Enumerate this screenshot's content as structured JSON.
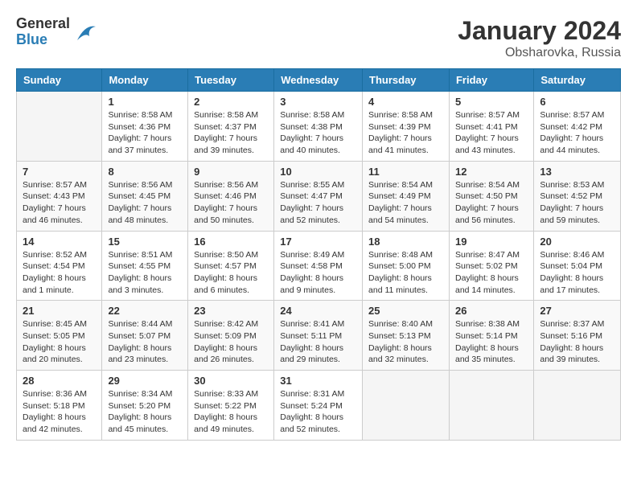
{
  "logo": {
    "general": "General",
    "blue": "Blue"
  },
  "title": {
    "month_year": "January 2024",
    "location": "Obsharovka, Russia"
  },
  "days_of_week": [
    "Sunday",
    "Monday",
    "Tuesday",
    "Wednesday",
    "Thursday",
    "Friday",
    "Saturday"
  ],
  "weeks": [
    [
      {
        "day": "",
        "sunrise": "",
        "sunset": "",
        "daylight": ""
      },
      {
        "day": "1",
        "sunrise": "Sunrise: 8:58 AM",
        "sunset": "Sunset: 4:36 PM",
        "daylight": "Daylight: 7 hours and 37 minutes."
      },
      {
        "day": "2",
        "sunrise": "Sunrise: 8:58 AM",
        "sunset": "Sunset: 4:37 PM",
        "daylight": "Daylight: 7 hours and 39 minutes."
      },
      {
        "day": "3",
        "sunrise": "Sunrise: 8:58 AM",
        "sunset": "Sunset: 4:38 PM",
        "daylight": "Daylight: 7 hours and 40 minutes."
      },
      {
        "day": "4",
        "sunrise": "Sunrise: 8:58 AM",
        "sunset": "Sunset: 4:39 PM",
        "daylight": "Daylight: 7 hours and 41 minutes."
      },
      {
        "day": "5",
        "sunrise": "Sunrise: 8:57 AM",
        "sunset": "Sunset: 4:41 PM",
        "daylight": "Daylight: 7 hours and 43 minutes."
      },
      {
        "day": "6",
        "sunrise": "Sunrise: 8:57 AM",
        "sunset": "Sunset: 4:42 PM",
        "daylight": "Daylight: 7 hours and 44 minutes."
      }
    ],
    [
      {
        "day": "7",
        "sunrise": "Sunrise: 8:57 AM",
        "sunset": "Sunset: 4:43 PM",
        "daylight": "Daylight: 7 hours and 46 minutes."
      },
      {
        "day": "8",
        "sunrise": "Sunrise: 8:56 AM",
        "sunset": "Sunset: 4:45 PM",
        "daylight": "Daylight: 7 hours and 48 minutes."
      },
      {
        "day": "9",
        "sunrise": "Sunrise: 8:56 AM",
        "sunset": "Sunset: 4:46 PM",
        "daylight": "Daylight: 7 hours and 50 minutes."
      },
      {
        "day": "10",
        "sunrise": "Sunrise: 8:55 AM",
        "sunset": "Sunset: 4:47 PM",
        "daylight": "Daylight: 7 hours and 52 minutes."
      },
      {
        "day": "11",
        "sunrise": "Sunrise: 8:54 AM",
        "sunset": "Sunset: 4:49 PM",
        "daylight": "Daylight: 7 hours and 54 minutes."
      },
      {
        "day": "12",
        "sunrise": "Sunrise: 8:54 AM",
        "sunset": "Sunset: 4:50 PM",
        "daylight": "Daylight: 7 hours and 56 minutes."
      },
      {
        "day": "13",
        "sunrise": "Sunrise: 8:53 AM",
        "sunset": "Sunset: 4:52 PM",
        "daylight": "Daylight: 7 hours and 59 minutes."
      }
    ],
    [
      {
        "day": "14",
        "sunrise": "Sunrise: 8:52 AM",
        "sunset": "Sunset: 4:54 PM",
        "daylight": "Daylight: 8 hours and 1 minute."
      },
      {
        "day": "15",
        "sunrise": "Sunrise: 8:51 AM",
        "sunset": "Sunset: 4:55 PM",
        "daylight": "Daylight: 8 hours and 3 minutes."
      },
      {
        "day": "16",
        "sunrise": "Sunrise: 8:50 AM",
        "sunset": "Sunset: 4:57 PM",
        "daylight": "Daylight: 8 hours and 6 minutes."
      },
      {
        "day": "17",
        "sunrise": "Sunrise: 8:49 AM",
        "sunset": "Sunset: 4:58 PM",
        "daylight": "Daylight: 8 hours and 9 minutes."
      },
      {
        "day": "18",
        "sunrise": "Sunrise: 8:48 AM",
        "sunset": "Sunset: 5:00 PM",
        "daylight": "Daylight: 8 hours and 11 minutes."
      },
      {
        "day": "19",
        "sunrise": "Sunrise: 8:47 AM",
        "sunset": "Sunset: 5:02 PM",
        "daylight": "Daylight: 8 hours and 14 minutes."
      },
      {
        "day": "20",
        "sunrise": "Sunrise: 8:46 AM",
        "sunset": "Sunset: 5:04 PM",
        "daylight": "Daylight: 8 hours and 17 minutes."
      }
    ],
    [
      {
        "day": "21",
        "sunrise": "Sunrise: 8:45 AM",
        "sunset": "Sunset: 5:05 PM",
        "daylight": "Daylight: 8 hours and 20 minutes."
      },
      {
        "day": "22",
        "sunrise": "Sunrise: 8:44 AM",
        "sunset": "Sunset: 5:07 PM",
        "daylight": "Daylight: 8 hours and 23 minutes."
      },
      {
        "day": "23",
        "sunrise": "Sunrise: 8:42 AM",
        "sunset": "Sunset: 5:09 PM",
        "daylight": "Daylight: 8 hours and 26 minutes."
      },
      {
        "day": "24",
        "sunrise": "Sunrise: 8:41 AM",
        "sunset": "Sunset: 5:11 PM",
        "daylight": "Daylight: 8 hours and 29 minutes."
      },
      {
        "day": "25",
        "sunrise": "Sunrise: 8:40 AM",
        "sunset": "Sunset: 5:13 PM",
        "daylight": "Daylight: 8 hours and 32 minutes."
      },
      {
        "day": "26",
        "sunrise": "Sunrise: 8:38 AM",
        "sunset": "Sunset: 5:14 PM",
        "daylight": "Daylight: 8 hours and 35 minutes."
      },
      {
        "day": "27",
        "sunrise": "Sunrise: 8:37 AM",
        "sunset": "Sunset: 5:16 PM",
        "daylight": "Daylight: 8 hours and 39 minutes."
      }
    ],
    [
      {
        "day": "28",
        "sunrise": "Sunrise: 8:36 AM",
        "sunset": "Sunset: 5:18 PM",
        "daylight": "Daylight: 8 hours and 42 minutes."
      },
      {
        "day": "29",
        "sunrise": "Sunrise: 8:34 AM",
        "sunset": "Sunset: 5:20 PM",
        "daylight": "Daylight: 8 hours and 45 minutes."
      },
      {
        "day": "30",
        "sunrise": "Sunrise: 8:33 AM",
        "sunset": "Sunset: 5:22 PM",
        "daylight": "Daylight: 8 hours and 49 minutes."
      },
      {
        "day": "31",
        "sunrise": "Sunrise: 8:31 AM",
        "sunset": "Sunset: 5:24 PM",
        "daylight": "Daylight: 8 hours and 52 minutes."
      },
      {
        "day": "",
        "sunrise": "",
        "sunset": "",
        "daylight": ""
      },
      {
        "day": "",
        "sunrise": "",
        "sunset": "",
        "daylight": ""
      },
      {
        "day": "",
        "sunrise": "",
        "sunset": "",
        "daylight": ""
      }
    ]
  ]
}
